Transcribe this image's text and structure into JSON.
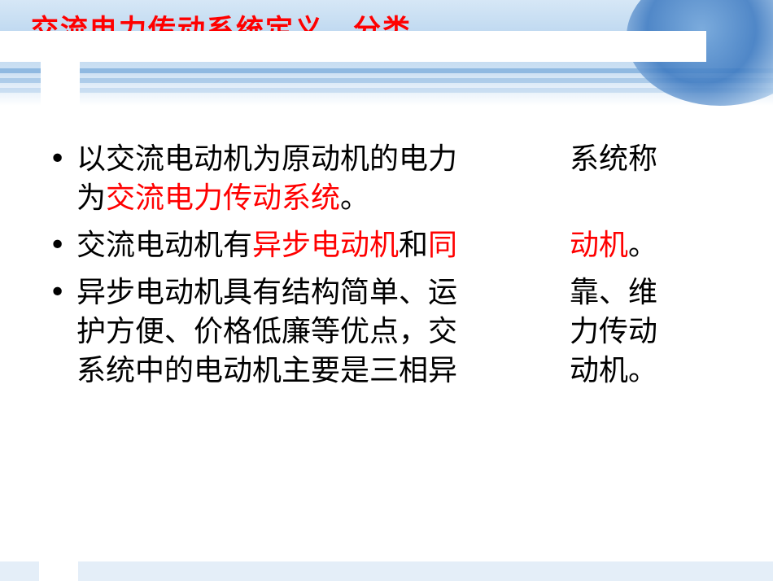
{
  "slide": {
    "title": "交流电力传动系统定义、分类",
    "bullets": [
      {
        "lines": [
          {
            "left": [
              {
                "text": "以交流电动机为原动机的电力",
                "red": false
              }
            ],
            "right": [
              {
                "text": "系统称",
                "red": false
              }
            ]
          },
          {
            "left": [
              {
                "text": "为",
                "red": false
              },
              {
                "text": "交流电力传动系统",
                "red": true
              },
              {
                "text": "。",
                "red": false
              }
            ],
            "right": []
          }
        ]
      },
      {
        "lines": [
          {
            "left": [
              {
                "text": "交流电动机有",
                "red": false
              },
              {
                "text": "异步电动机",
                "red": true
              },
              {
                "text": "和",
                "red": false
              },
              {
                "text": "同",
                "red": true
              }
            ],
            "right": [
              {
                "text": "动机",
                "red": true
              },
              {
                "text": "。",
                "red": false
              }
            ]
          }
        ]
      },
      {
        "lines": [
          {
            "left": [
              {
                "text": "异步电动机具有结构简单、运",
                "red": false
              }
            ],
            "right": [
              {
                "text": "靠、维",
                "red": false
              }
            ]
          },
          {
            "left": [
              {
                "text": "护方便、价格低廉等优点，交",
                "red": false
              }
            ],
            "right": [
              {
                "text": "力传动",
                "red": false
              }
            ]
          },
          {
            "left": [
              {
                "text": "系统中的电动机主要是三相异",
                "red": false
              }
            ],
            "right": [
              {
                "text": "动机。",
                "red": false
              }
            ]
          }
        ]
      }
    ],
    "colors": {
      "accent": "#ff0000",
      "header_blue": "#b9d5ef"
    }
  }
}
